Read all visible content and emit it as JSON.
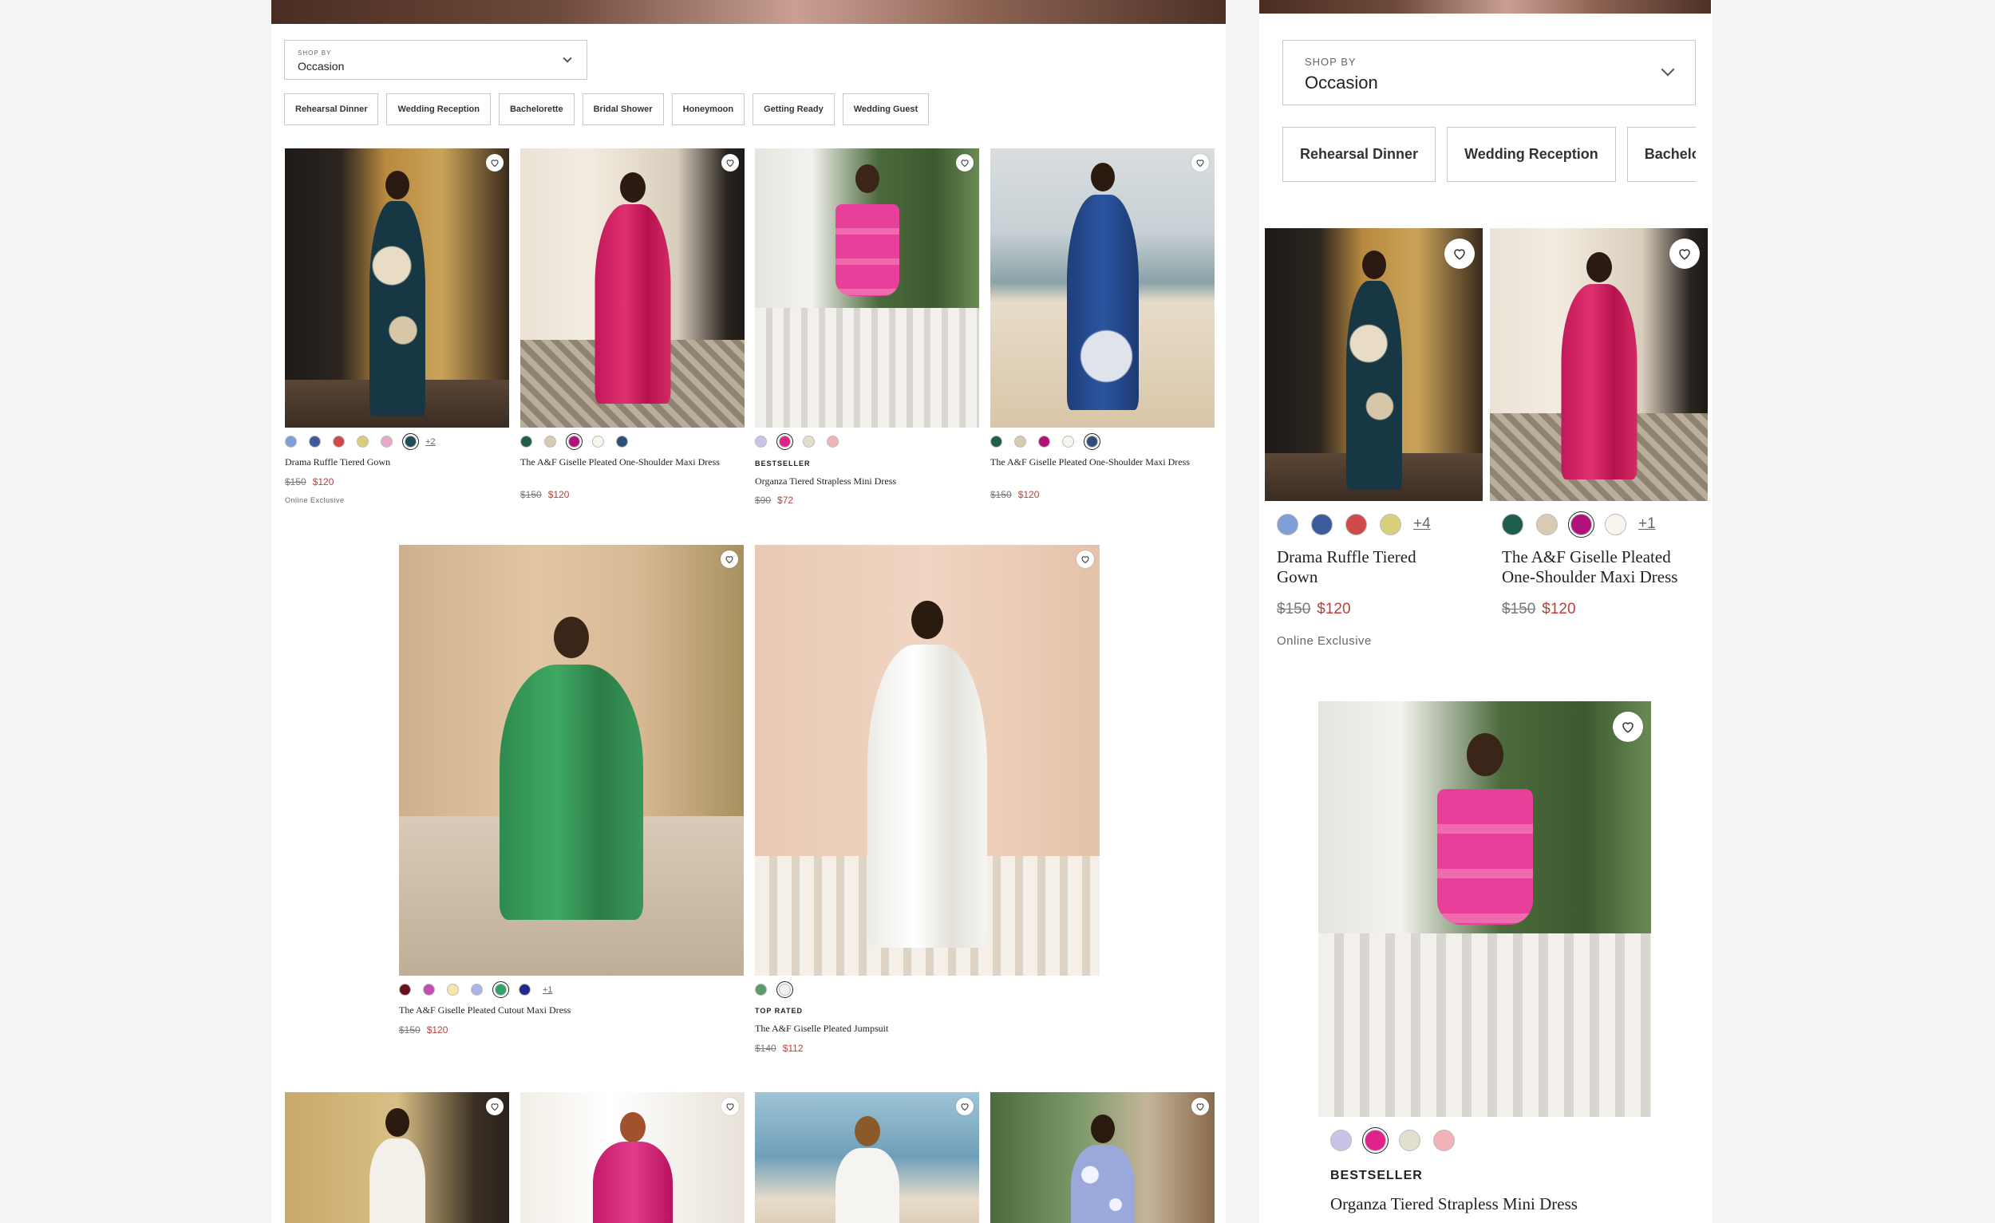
{
  "shop_by": {
    "label": "SHOP BY",
    "value": "Occasion"
  },
  "chips_desktop": [
    "Rehearsal Dinner",
    "Wedding Reception",
    "Bachelorette",
    "Bridal Shower",
    "Honeymoon",
    "Getting Ready",
    "Wedding Guest"
  ],
  "chips_mobile": [
    "Rehearsal Dinner",
    "Wedding Reception",
    "Bachelorette"
  ],
  "products": [
    {
      "name": "Drama Ruffle Tiered Gown",
      "price_original": "$150",
      "price_sale": "$120",
      "badge": "",
      "note": "Online Exclusive",
      "more_desktop": "+2",
      "more_mobile": "+4",
      "swatches_desktop": [
        "#7f9fd6",
        "#3c5a9c",
        "#d14a4a",
        "#d7cf7a",
        "#e7a8c9",
        "#1e4e55"
      ],
      "swatches_mobile": [
        "#7f9fd6",
        "#3c5a9c",
        "#d14a4a",
        "#d7cf7a"
      ],
      "selected_index": 5
    },
    {
      "name": "The A&F Giselle Pleated One-Shoulder Maxi Dress",
      "price_original": "$150",
      "price_sale": "$120",
      "badge": "",
      "note": "",
      "more_desktop": "",
      "more_mobile": "+1",
      "swatches_desktop": [
        "#1d5e4c",
        "#d9cbb3",
        "#b0127a",
        "#f7f5ee",
        "#2f4f7a"
      ],
      "swatches_mobile": [
        "#1d5e4c",
        "#d9cbb3",
        "#b0127a",
        "#f7f5ee"
      ],
      "selected_index": 2
    },
    {
      "name": "Organza Tiered Strapless Mini Dress",
      "price_original": "$90",
      "price_sale": "$72",
      "badge": "BESTSELLER",
      "note": "",
      "more_desktop": "",
      "more_mobile": "",
      "swatches_desktop": [
        "#c9c3e6",
        "#e0228a",
        "#e3dfcf",
        "#f1b2b8"
      ],
      "swatches_mobile": [
        "#c9c3e6",
        "#e0228a",
        "#e3dfcf",
        "#f1b2b8"
      ],
      "selected_index": 1
    },
    {
      "name": "The A&F Giselle Pleated One-Shoulder Maxi Dress",
      "price_original": "$150",
      "price_sale": "$120",
      "badge": "",
      "note": "",
      "more_desktop": "",
      "more_mobile": "",
      "swatches_desktop": [
        "#1d5e4c",
        "#d9cbb3",
        "#b0127a",
        "#f7f5ee",
        "#2f4f7a"
      ],
      "swatches_mobile": [],
      "selected_index": 4
    },
    {
      "name": "The A&F Giselle Pleated Cutout Maxi Dress",
      "price_original": "$150",
      "price_sale": "$120",
      "badge": "",
      "note": "",
      "more_desktop": "+1",
      "more_mobile": "",
      "swatches_desktop": [
        "#6b0f1a",
        "#c24fb0",
        "#f5e7a8",
        "#a9b5e6",
        "#2fa36a",
        "#1d2c8a"
      ],
      "swatches_mobile": [],
      "selected_index": 4
    },
    {
      "name": "The A&F Giselle Pleated Jumpsuit",
      "price_original": "$140",
      "price_sale": "$112",
      "badge": "TOP RATED",
      "note": "",
      "more_desktop": "",
      "more_mobile": "",
      "swatches_desktop": [
        "#5e9a6c",
        "#f1f1f1"
      ],
      "swatches_mobile": [],
      "selected_index": 1
    }
  ],
  "colors": {
    "sale": "#b5413a",
    "border": "#c8c8c8"
  },
  "icons": {
    "wishlist": "heart-icon",
    "dropdown": "chevron-down-icon"
  }
}
